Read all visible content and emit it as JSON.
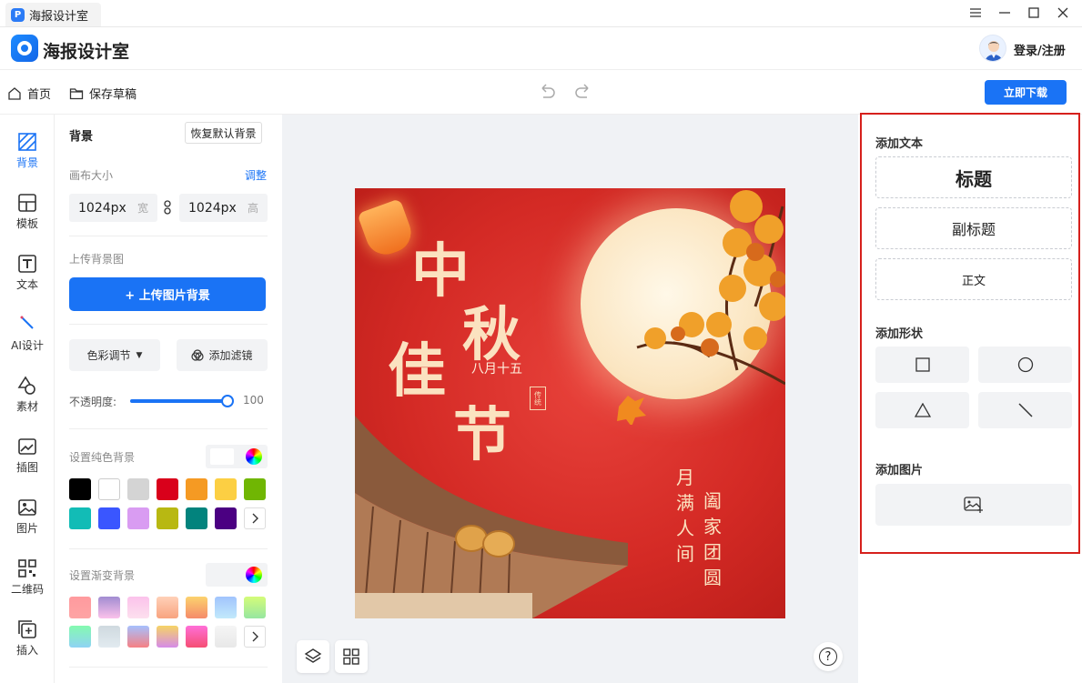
{
  "window": {
    "tab_title": "海报设计室",
    "logo_letter": "P"
  },
  "header": {
    "app_name": "海报设计室",
    "login_label": "登录/注册"
  },
  "toolbar": {
    "home_label": "首页",
    "save_draft_label": "保存草稿",
    "download_label": "立即下载"
  },
  "left_nav": [
    {
      "label": "背景",
      "icon": "background-hatch-icon",
      "active": true
    },
    {
      "label": "模板",
      "icon": "template-icon"
    },
    {
      "label": "文本",
      "icon": "text-icon"
    },
    {
      "label": "AI设计",
      "icon": "ai-design-icon"
    },
    {
      "label": "素材",
      "icon": "material-icon"
    },
    {
      "label": "插图",
      "icon": "illustration-icon"
    },
    {
      "label": "图片",
      "icon": "image-icon"
    },
    {
      "label": "二维码",
      "icon": "qrcode-icon"
    },
    {
      "label": "插入",
      "icon": "insert-icon"
    }
  ],
  "panel": {
    "title": "背景",
    "reset_label": "恢复默认背景",
    "canvas_size_label": "画布大小",
    "adjust_label": "调整",
    "width_value": "1024px",
    "width_unit": "宽",
    "height_value": "1024px",
    "height_unit": "高",
    "upload_section_label": "上传背景图",
    "upload_button_label": "+ 上传图片背景",
    "color_adjust_label": "色彩调节",
    "filter_label": "添加滤镜",
    "opacity_label": "不透明度:",
    "opacity_value": "100",
    "opacity_fraction": 1.0,
    "solid_bg_label": "设置纯色背景",
    "solid_colors": [
      "#000000",
      "#ffffff",
      "#d4d4d4",
      "#d9001b",
      "#f59a23",
      "#fccf43",
      "#70b603",
      "#12bcb6",
      "#3a56ff",
      "#d99cf2",
      "#b8b812",
      "#02837d",
      "#4b0082"
    ],
    "gradient_bg_label": "设置渐变背景",
    "gradient_colors": [
      [
        "#ff9a9e",
        "#fda4a4"
      ],
      [
        "#a18cd1",
        "#fbc2eb"
      ],
      [
        "#fbc2eb",
        "#fde0ee"
      ],
      [
        "#ffd1b8",
        "#f8a37f"
      ],
      [
        "#fcd26e",
        "#f58a6a"
      ],
      [
        "#a1c4fd",
        "#c2e9fb"
      ],
      [
        "#d4fc79",
        "#96e6a1"
      ],
      [
        "#84fab0",
        "#8fd3f4"
      ],
      [
        "#cfd9df",
        "#e2ebf0"
      ],
      [
        "#a6c0fe",
        "#f68084"
      ],
      [
        "#f6d365",
        "#d58be8"
      ],
      [
        "#ff6fd8",
        "#f54e73"
      ],
      [
        "#f5f5f5",
        "#e8e8e8"
      ]
    ]
  },
  "poster": {
    "title_chars": [
      "中",
      "秋",
      "佳",
      "节"
    ],
    "date_text": "八月十五",
    "seal_text": "传统",
    "poem_col1": [
      "月",
      "满",
      "人",
      "间"
    ],
    "poem_col2": [
      "阖",
      "家",
      "团",
      "圆"
    ]
  },
  "right_panel": {
    "add_text_label": "添加文本",
    "heading_label": "标题",
    "subheading_label": "副标题",
    "body_label": "正文",
    "add_shape_label": "添加形状",
    "add_image_label": "添加图片"
  },
  "canvas_bottom": {
    "help_label": "?"
  }
}
